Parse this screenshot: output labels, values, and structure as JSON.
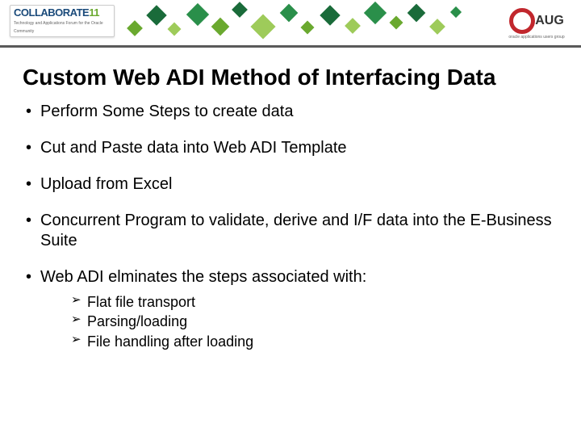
{
  "header": {
    "collab_brand": "COLLABORATE",
    "collab_year": "11",
    "collab_sub": "Technology and Applications Forum for the Oracle Community",
    "oaug_text": "AUG",
    "oaug_sub": "oracle applications users group"
  },
  "title": "Custom Web ADI Method of Interfacing Data",
  "bullets": [
    {
      "text": "Perform Some Steps to create data"
    },
    {
      "text": "Cut and Paste data into Web ADI Template"
    },
    {
      "text": "Upload from Excel"
    },
    {
      "text": "Concurrent Program to validate, derive and I/F data into the E-Business Suite"
    },
    {
      "text": "Web ADI elminates the steps associated with:",
      "sub": [
        "Flat file transport",
        "Parsing/loading",
        "File handling after loading"
      ]
    }
  ]
}
